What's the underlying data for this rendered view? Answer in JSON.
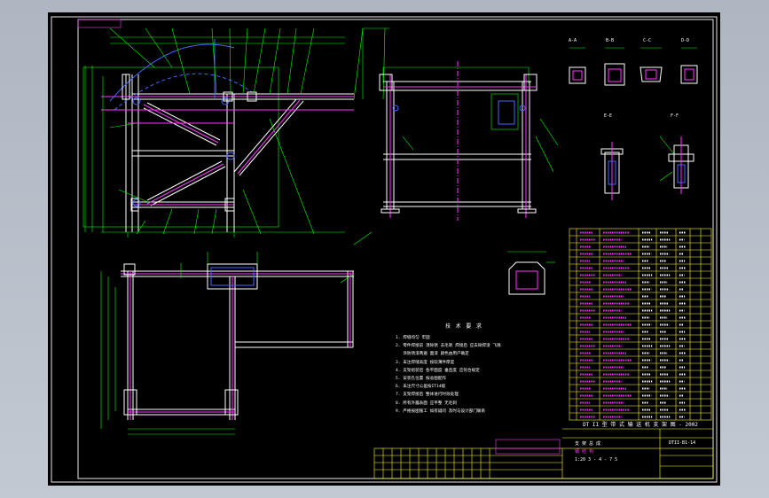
{
  "drawing": {
    "title_ribbon": "DT II 型 带 式 输 送 机 支 架 图 - 2002",
    "notes_heading": "技 术 要 求",
    "notes": [
      "1. 焊缝均匀 牢固",
      "2. 零件焊接前 须除锈 去毛刺 焊接后 应去除焊渣 飞溅",
      "   涂防锈漆两遍 面漆 颜色由用户确定",
      "3. 未注焊缝高度 按较薄件厚度",
      "4. 支架组装后 各平面度 垂直度 应符合规定",
      "5. 安装孔位置 按总图配作",
      "6. 未注尺寸公差按IT14级",
      "7. 支架焊接后 整体进行时效处理",
      "8. 所有外露表面 应平整 无毛刺",
      "9. 严格按图施工 如有疑问 及时与设计部门联系"
    ],
    "section_labels": [
      "A-A",
      "B-B",
      "C-C",
      "D-D",
      "E-E",
      "F-F"
    ],
    "title_block": {
      "label_1": "支 架 总 成",
      "label_2": "钢 结 构",
      "scale_info": "1:20 3 - 4 - 7 5",
      "drawing_no": "DTII-B1-14"
    }
  }
}
